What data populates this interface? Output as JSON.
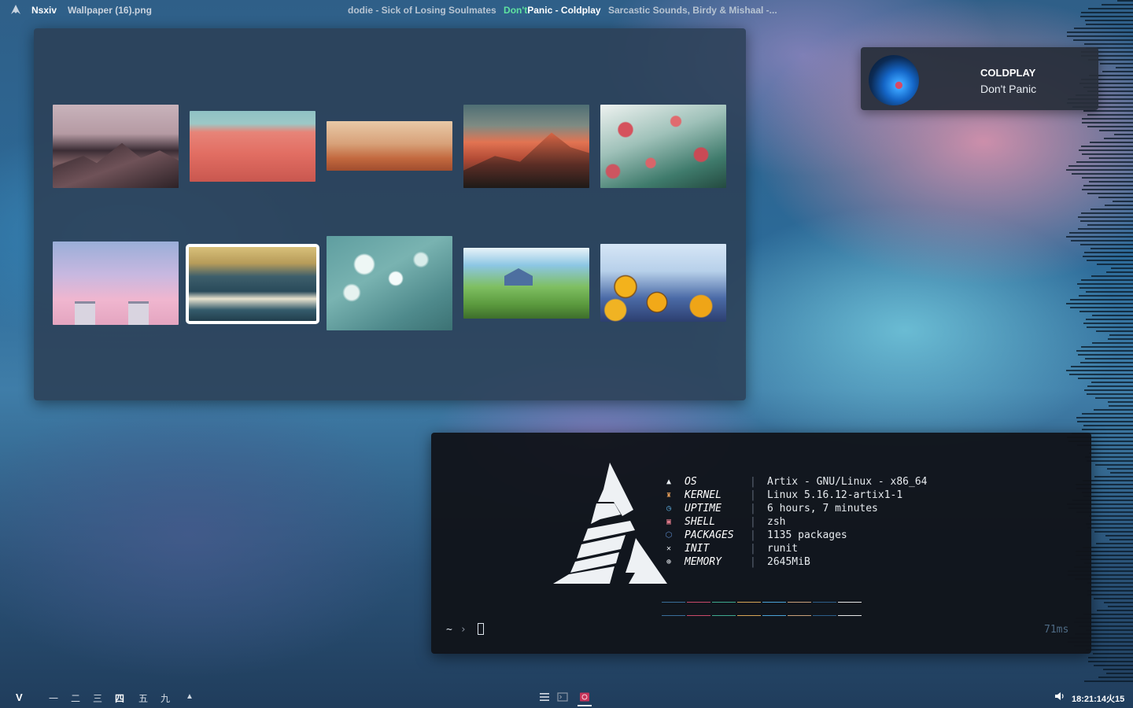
{
  "topbar": {
    "app_name": "Nsxiv",
    "file_name": "Wallpaper (16).png",
    "tracks": {
      "prev": "dodie - Sick of Losing Soulmates",
      "current_a": "Don't",
      "current_b": "Panic - Coldplay",
      "next": "Sarcastic Sounds, Birdy & Mishaal -..."
    }
  },
  "viewer": {
    "selected_index": 7,
    "thumbnail_count": 10
  },
  "notification": {
    "artist": "COLDPLAY",
    "song": "Don't Panic",
    "icon": "album-art"
  },
  "terminal": {
    "info": [
      {
        "icon": "artix-icon",
        "key": "OS",
        "value": "Artix - GNU/Linux - x86_64",
        "color": "#e9edf2"
      },
      {
        "icon": "kernel-icon",
        "key": "KERNEL",
        "value": "Linux 5.16.12-artix1-1",
        "color": "#e8a05a"
      },
      {
        "icon": "clock-icon",
        "key": "UPTIME",
        "value": "6 hours, 7 minutes",
        "color": "#5aa7d8"
      },
      {
        "icon": "shell-icon",
        "key": "SHELL",
        "value": "zsh",
        "color": "#e07a8a"
      },
      {
        "icon": "package-icon",
        "key": "PACKAGES",
        "value": "1135 packages",
        "color": "#5a86c8"
      },
      {
        "icon": "init-icon",
        "key": "INIT",
        "value": "runit",
        "color": "#e9edf2"
      },
      {
        "icon": "memory-icon",
        "key": "MEMORY",
        "value": "2645MiB",
        "color": "#e9edf2"
      }
    ],
    "separator": "|",
    "palette": [
      "#3a6f9a",
      "#c94a6a",
      "#3fa88f",
      "#d6a456",
      "#4aa2d6",
      "#c8a07a",
      "#2d5f8a",
      "#e6e6e6"
    ],
    "prompt_tilde": "~",
    "prompt_chevron": "›",
    "timing": "71ms"
  },
  "bottombar": {
    "launcher": "V",
    "workspaces": [
      "一",
      "二",
      "三",
      "四",
      "五",
      "九"
    ],
    "active_workspace": "四",
    "more": "▲",
    "clock": "18:21:14火15"
  }
}
